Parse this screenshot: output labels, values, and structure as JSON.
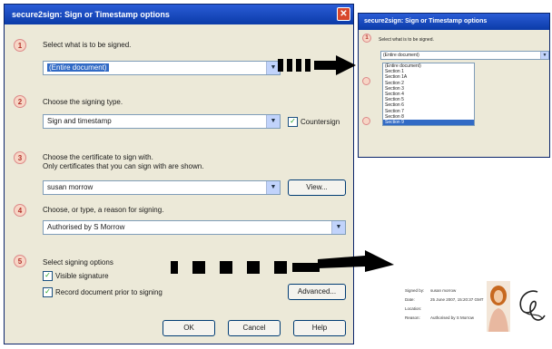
{
  "dialog": {
    "title": "secure2sign: Sign or Timestamp options",
    "close_glyph": "✕",
    "steps": [
      "1",
      "2",
      "3",
      "4",
      "5"
    ],
    "step1_label": "Select what is to be signed.",
    "document_value": "(Entire document)",
    "step2_label": "Choose the signing type.",
    "signing_type_value": "Sign and timestamp",
    "countersign_label": "Countersign",
    "step3_label": "Choose the certificate to sign with.",
    "step3_sub": "Only certificates that you can sign with are shown.",
    "certificate_value": "susan morrow",
    "view_button": "View...",
    "step4_label": "Choose, or type, a reason for signing.",
    "reason_value": "Authorised by S Morrow",
    "step5_label": "Select signing options",
    "visible_signature_label": "Visible signature",
    "record_document_label": "Record document prior to signing",
    "advanced_button": "Advanced...",
    "ok_button": "OK",
    "cancel_button": "Cancel",
    "help_button": "Help"
  },
  "panel": {
    "title": "secure2sign: Sign or Timestamp options",
    "step1_label": "Select what is to be signed.",
    "dropdown_value": "(Entire document)",
    "options": [
      "(Entire document)",
      "Section 1",
      "Section 1A",
      "Section 2",
      "Section 3",
      "Section 4",
      "Section 5",
      "Section 6",
      "Section 7",
      "Section 8",
      "Section 9"
    ],
    "selected_option": "Section 9"
  },
  "signature": {
    "signed_by_label": "Signed by:",
    "signed_by_value": "susan morrow",
    "date_label": "Date:",
    "date_value": "25 June 2007, 15:20:37 GMT",
    "location_label": "Location:",
    "reason_label": "Reason:",
    "reason_value": "Authorised by S Morrow"
  },
  "colors": {
    "titlebar": "#0b3ba8",
    "selection": "#316ac5",
    "arrow": "#000000"
  }
}
